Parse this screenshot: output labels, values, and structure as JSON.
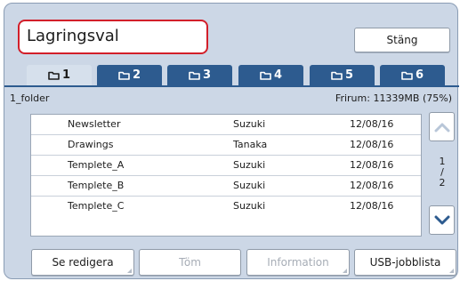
{
  "dialog": {
    "title": "Lagringsval",
    "close_label": "Stäng"
  },
  "tabs": [
    {
      "label": "1",
      "active": true
    },
    {
      "label": "2",
      "active": false
    },
    {
      "label": "3",
      "active": false
    },
    {
      "label": "4",
      "active": false
    },
    {
      "label": "5",
      "active": false
    },
    {
      "label": "6",
      "active": false
    }
  ],
  "folder": {
    "name": "1_folder",
    "free_space": "Frirum: 11339MB (75%)"
  },
  "documents": [
    {
      "name": "Newsletter",
      "owner": "Suzuki",
      "date": "12/08/16"
    },
    {
      "name": "Drawings",
      "owner": "Tanaka",
      "date": "12/08/16"
    },
    {
      "name": "Templete_A",
      "owner": "Suzuki",
      "date": "12/08/16"
    },
    {
      "name": "Templete_B",
      "owner": "Suzuki",
      "date": "12/08/16"
    },
    {
      "name": "Templete_C",
      "owner": "Suzuki",
      "date": "12/08/16"
    }
  ],
  "pagination": {
    "current": "1",
    "separator": "/",
    "total": "2"
  },
  "actions": {
    "edit_label": "Se redigera",
    "empty_label": "Töm",
    "info_label": "Information",
    "usb_label": "USB-jobblista"
  },
  "colors": {
    "panel_bg": "#ccd7e6",
    "tab_blue": "#2d5b8f",
    "highlight_red": "#d21f2a",
    "scroll_arrow_active": "#2d5b8f",
    "scroll_arrow_disabled": "#b8c6d8"
  },
  "icons": {
    "tab_icon": "folder-icon",
    "scroll_up": "chevron-up-icon",
    "scroll_down": "chevron-down-icon"
  }
}
